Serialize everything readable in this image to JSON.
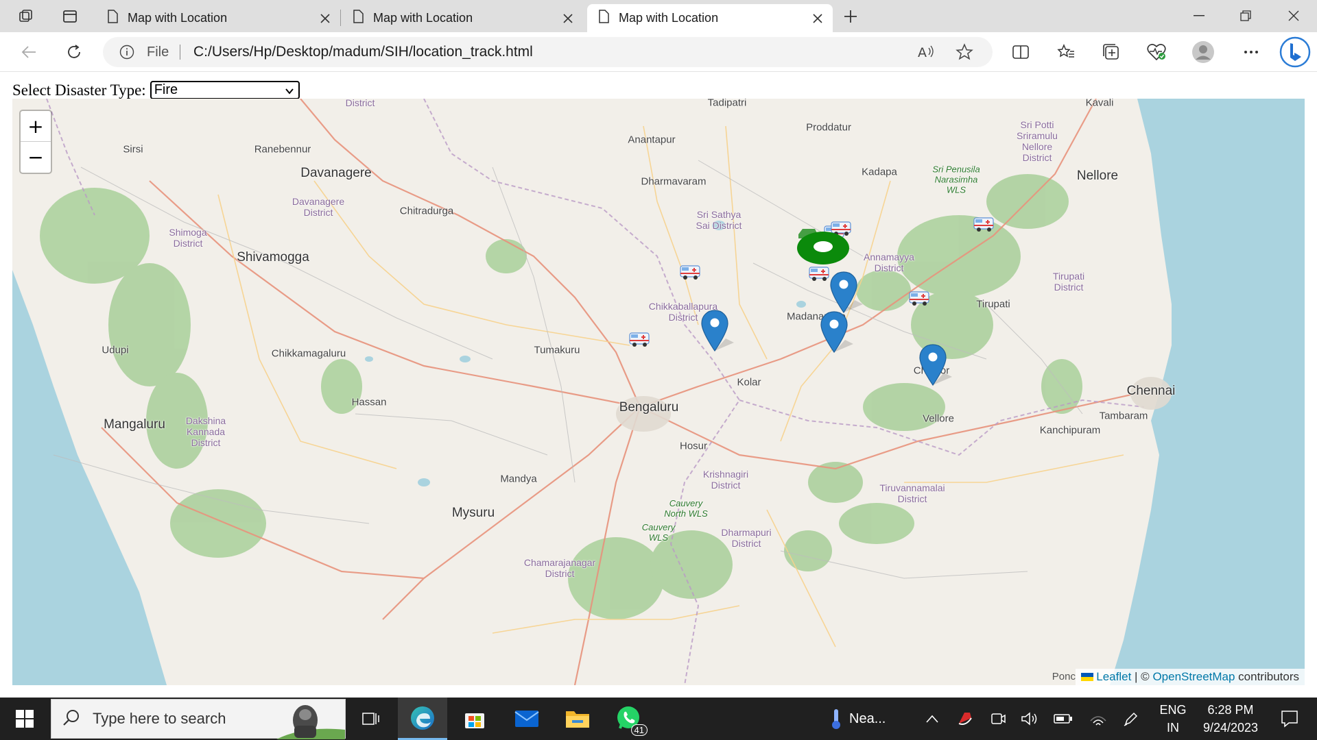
{
  "browser": {
    "tabs": [
      {
        "title": "Map with Location",
        "active": false
      },
      {
        "title": "Map with Location",
        "active": false
      },
      {
        "title": "Map with Location",
        "active": true
      }
    ],
    "address": {
      "scheme_label": "File",
      "url": "C:/Users/Hp/Desktop/madum/SIH/location_track.html"
    },
    "icons": [
      "workspaces-icon",
      "tab-actions-icon",
      "page-icon",
      "close-icon",
      "new-tab-icon",
      "minimize-icon",
      "restore-icon",
      "close-window-icon",
      "back-icon",
      "refresh-icon",
      "info-icon",
      "read-aloud-icon",
      "favorite-star-icon",
      "split-screen-icon",
      "favorites-icon",
      "collections-icon",
      "browser-essentials-icon",
      "profile-icon",
      "more-icon",
      "bing-icon"
    ]
  },
  "page": {
    "select_label": "Select Disaster Type:",
    "select_value": "Fire"
  },
  "map": {
    "zoom_in": "+",
    "zoom_out": "−",
    "places": [
      {
        "name": "Tadipatri",
        "kind": "town"
      },
      {
        "name": "Kavali",
        "kind": "town"
      },
      {
        "name": "Proddatur",
        "kind": "town"
      },
      {
        "name": "Anantapur",
        "kind": "town"
      },
      {
        "name": "Sri Potti\nSriramulu\nNellore\nDistrict",
        "kind": "district"
      },
      {
        "name": "Sirsi",
        "kind": "town"
      },
      {
        "name": "Ranebennur",
        "kind": "town"
      },
      {
        "name": "District",
        "kind": "district"
      },
      {
        "name": "Davanagere",
        "kind": "city"
      },
      {
        "name": "Dharmavaram",
        "kind": "town"
      },
      {
        "name": "Kadapa",
        "kind": "town"
      },
      {
        "name": "Sri Penusila\nNarasimha\nWLS",
        "kind": "wls"
      },
      {
        "name": "Nellore",
        "kind": "city"
      },
      {
        "name": "Davanagere\nDistrict",
        "kind": "district"
      },
      {
        "name": "Chitradurga",
        "kind": "town"
      },
      {
        "name": "Sri Sathya\nSai District",
        "kind": "district"
      },
      {
        "name": "Shimoga\nDistrict",
        "kind": "district"
      },
      {
        "name": "Shivamogga",
        "kind": "city"
      },
      {
        "name": "Annamayya\nDistrict",
        "kind": "district"
      },
      {
        "name": "Tirupati\nDistrict",
        "kind": "district"
      },
      {
        "name": "Tirupati",
        "kind": "town"
      },
      {
        "name": "Chikkaballapura\nDistrict",
        "kind": "district"
      },
      {
        "name": "Madanapalle",
        "kind": "town"
      },
      {
        "name": "Udupi",
        "kind": "town"
      },
      {
        "name": "Chikkamagaluru",
        "kind": "town"
      },
      {
        "name": "Tumakuru",
        "kind": "town"
      },
      {
        "name": "Chittoor",
        "kind": "town"
      },
      {
        "name": "Kolar",
        "kind": "town"
      },
      {
        "name": "Chennai",
        "kind": "city"
      },
      {
        "name": "Hassan",
        "kind": "town"
      },
      {
        "name": "Bengaluru",
        "kind": "city"
      },
      {
        "name": "Vellore",
        "kind": "town"
      },
      {
        "name": "Tambaram",
        "kind": "town"
      },
      {
        "name": "Mangaluru",
        "kind": "city"
      },
      {
        "name": "Dakshina\nKannada\nDistrict",
        "kind": "district"
      },
      {
        "name": "Kanchipuram",
        "kind": "town"
      },
      {
        "name": "Hosur",
        "kind": "town"
      },
      {
        "name": "Krishnagiri\nDistrict",
        "kind": "district"
      },
      {
        "name": "Mandya",
        "kind": "town"
      },
      {
        "name": "Tiruvannamalai\nDistrict",
        "kind": "district"
      },
      {
        "name": "Cauvery\nNorth WLS",
        "kind": "wls"
      },
      {
        "name": "Mysuru",
        "kind": "city"
      },
      {
        "name": "Cauvery\nWLS",
        "kind": "wls"
      },
      {
        "name": "Dharmapuri\nDistrict",
        "kind": "district"
      },
      {
        "name": "Chamarajanagar\nDistrict",
        "kind": "district"
      }
    ],
    "markers": {
      "blue_pins": 4,
      "current_location": 1,
      "ambulance_icons": 7
    },
    "attribution": {
      "leaflet": "Leaflet",
      "separator": " | © ",
      "osm": "OpenStreetMap",
      "suffix": " contributors",
      "partial_place": "Ponc"
    }
  },
  "taskbar": {
    "search_placeholder": "Type here to search",
    "weather_text": "Nea...",
    "language_top": "ENG",
    "language_bottom": "IN",
    "time": "6:28 PM",
    "date": "9/24/2023",
    "whatsapp_badge": "41",
    "icons": [
      "start-icon",
      "search-icon",
      "gorilla-search-highlight",
      "task-view-icon",
      "edge-icon",
      "store-icon",
      "mail-icon",
      "file-explorer-icon",
      "whatsapp-icon",
      "temperature-icon",
      "chevron-up-icon",
      "antivirus-icon",
      "meet-icon",
      "volume-icon",
      "battery-icon",
      "wifi-icon",
      "pen-icon",
      "notification-icon"
    ]
  }
}
